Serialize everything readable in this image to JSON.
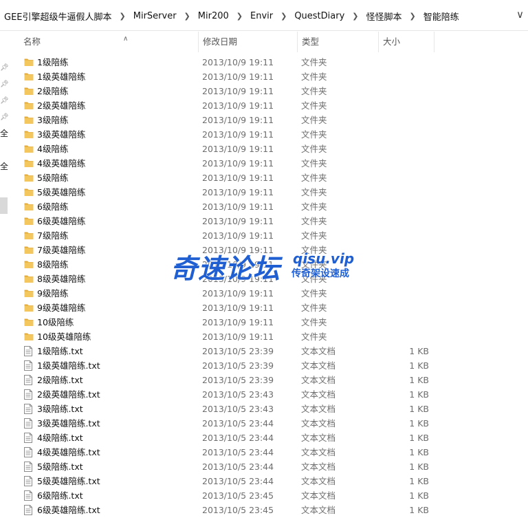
{
  "breadcrumb": [
    "GEE引擎超级牛逼假人脚本",
    "MirServer",
    "Mir200",
    "Envir",
    "QuestDiary",
    "怪怪脚本",
    "智能陪练"
  ],
  "nav": {
    "chars": [
      "全",
      "全"
    ]
  },
  "columns": {
    "name": "名称",
    "date": "修改日期",
    "type": "类型",
    "size": "大小"
  },
  "files": [
    {
      "name": "1级陪练",
      "date": "2013/10/9 19:11",
      "type": "文件夹",
      "size": "",
      "kind": "folder"
    },
    {
      "name": "1级英雄陪练",
      "date": "2013/10/9 19:11",
      "type": "文件夹",
      "size": "",
      "kind": "folder"
    },
    {
      "name": "2级陪练",
      "date": "2013/10/9 19:11",
      "type": "文件夹",
      "size": "",
      "kind": "folder"
    },
    {
      "name": "2级英雄陪练",
      "date": "2013/10/9 19:11",
      "type": "文件夹",
      "size": "",
      "kind": "folder"
    },
    {
      "name": "3级陪练",
      "date": "2013/10/9 19:11",
      "type": "文件夹",
      "size": "",
      "kind": "folder"
    },
    {
      "name": "3级英雄陪练",
      "date": "2013/10/9 19:11",
      "type": "文件夹",
      "size": "",
      "kind": "folder"
    },
    {
      "name": "4级陪练",
      "date": "2013/10/9 19:11",
      "type": "文件夹",
      "size": "",
      "kind": "folder"
    },
    {
      "name": "4级英雄陪练",
      "date": "2013/10/9 19:11",
      "type": "文件夹",
      "size": "",
      "kind": "folder"
    },
    {
      "name": "5级陪练",
      "date": "2013/10/9 19:11",
      "type": "文件夹",
      "size": "",
      "kind": "folder"
    },
    {
      "name": "5级英雄陪练",
      "date": "2013/10/9 19:11",
      "type": "文件夹",
      "size": "",
      "kind": "folder"
    },
    {
      "name": "6级陪练",
      "date": "2013/10/9 19:11",
      "type": "文件夹",
      "size": "",
      "kind": "folder"
    },
    {
      "name": "6级英雄陪练",
      "date": "2013/10/9 19:11",
      "type": "文件夹",
      "size": "",
      "kind": "folder"
    },
    {
      "name": "7级陪练",
      "date": "2013/10/9 19:11",
      "type": "文件夹",
      "size": "",
      "kind": "folder"
    },
    {
      "name": "7级英雄陪练",
      "date": "2013/10/9 19:11",
      "type": "文件夹",
      "size": "",
      "kind": "folder"
    },
    {
      "name": "8级陪练",
      "date": "2013/10/9 19:11",
      "type": "文件夹",
      "size": "",
      "kind": "folder"
    },
    {
      "name": "8级英雄陪练",
      "date": "2013/10/9 19:11",
      "type": "文件夹",
      "size": "",
      "kind": "folder"
    },
    {
      "name": "9级陪练",
      "date": "2013/10/9 19:11",
      "type": "文件夹",
      "size": "",
      "kind": "folder"
    },
    {
      "name": "9级英雄陪练",
      "date": "2013/10/9 19:11",
      "type": "文件夹",
      "size": "",
      "kind": "folder"
    },
    {
      "name": "10级陪练",
      "date": "2013/10/9 19:11",
      "type": "文件夹",
      "size": "",
      "kind": "folder"
    },
    {
      "name": "10级英雄陪练",
      "date": "2013/10/9 19:11",
      "type": "文件夹",
      "size": "",
      "kind": "folder"
    },
    {
      "name": "1级陪练.txt",
      "date": "2013/10/5 23:39",
      "type": "文本文档",
      "size": "1 KB",
      "kind": "file"
    },
    {
      "name": "1级英雄陪练.txt",
      "date": "2013/10/5 23:39",
      "type": "文本文档",
      "size": "1 KB",
      "kind": "file"
    },
    {
      "name": "2级陪练.txt",
      "date": "2013/10/5 23:39",
      "type": "文本文档",
      "size": "1 KB",
      "kind": "file"
    },
    {
      "name": "2级英雄陪练.txt",
      "date": "2013/10/5 23:43",
      "type": "文本文档",
      "size": "1 KB",
      "kind": "file"
    },
    {
      "name": "3级陪练.txt",
      "date": "2013/10/5 23:43",
      "type": "文本文档",
      "size": "1 KB",
      "kind": "file"
    },
    {
      "name": "3级英雄陪练.txt",
      "date": "2013/10/5 23:44",
      "type": "文本文档",
      "size": "1 KB",
      "kind": "file"
    },
    {
      "name": "4级陪练.txt",
      "date": "2013/10/5 23:44",
      "type": "文本文档",
      "size": "1 KB",
      "kind": "file"
    },
    {
      "name": "4级英雄陪练.txt",
      "date": "2013/10/5 23:44",
      "type": "文本文档",
      "size": "1 KB",
      "kind": "file"
    },
    {
      "name": "5级陪练.txt",
      "date": "2013/10/5 23:44",
      "type": "文本文档",
      "size": "1 KB",
      "kind": "file"
    },
    {
      "name": "5级英雄陪练.txt",
      "date": "2013/10/5 23:44",
      "type": "文本文档",
      "size": "1 KB",
      "kind": "file"
    },
    {
      "name": "6级陪练.txt",
      "date": "2013/10/5 23:45",
      "type": "文本文档",
      "size": "1 KB",
      "kind": "file"
    },
    {
      "name": "6级英雄陪练.txt",
      "date": "2013/10/5 23:45",
      "type": "文本文档",
      "size": "1 KB",
      "kind": "file"
    }
  ],
  "watermark": {
    "main": "奇速论坛",
    "url": "qisu.vip",
    "sub": "传奇架设速成"
  },
  "colors": {
    "folder": "#f3c75e",
    "folder_dark": "#e0a93a",
    "watermark": "#1f5fd1"
  }
}
